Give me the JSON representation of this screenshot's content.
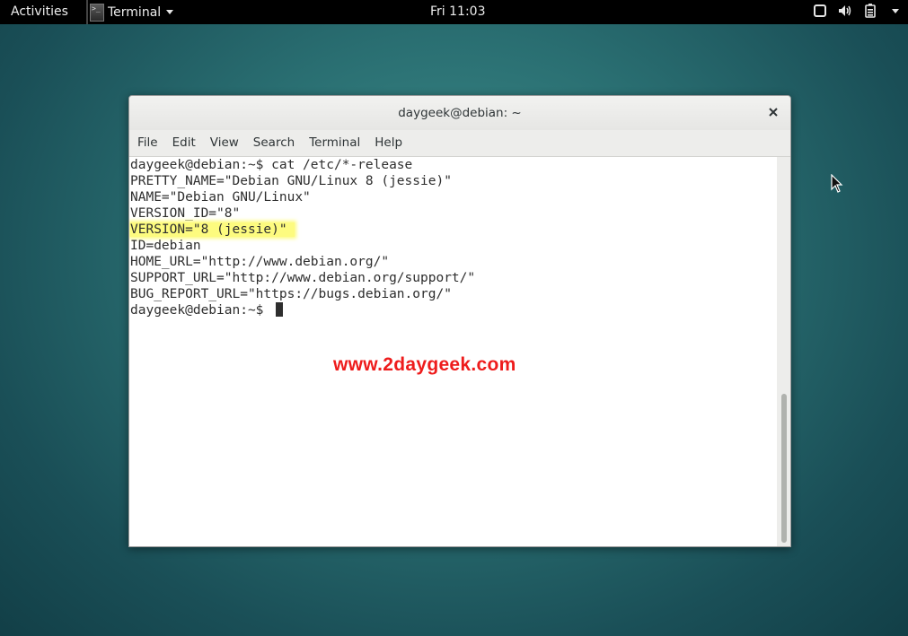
{
  "topbar": {
    "activities_label": "Activities",
    "app_menu_label": "Terminal",
    "app_icon_glyph": ">_",
    "clock": "Fri 11:03",
    "tray_icons": [
      "window-icon",
      "volume-icon",
      "battery-icon",
      "chevron-down-icon"
    ]
  },
  "window": {
    "title": "daygeek@debian: ~",
    "menu": [
      "File",
      "Edit",
      "View",
      "Search",
      "Terminal",
      "Help"
    ]
  },
  "terminal": {
    "lines": [
      "daygeek@debian:~$ cat /etc/*-release",
      "PRETTY_NAME=\"Debian GNU/Linux 8 (jessie)\"",
      "NAME=\"Debian GNU/Linux\"",
      "VERSION_ID=\"8\"",
      "VERSION=\"8 (jessie)\"",
      "ID=debian",
      "HOME_URL=\"http://www.debian.org/\"",
      "SUPPORT_URL=\"http://www.debian.org/support/\"",
      "BUG_REPORT_URL=\"https://bugs.debian.org/\"",
      "daygeek@debian:~$ "
    ],
    "highlighted_line": "VERSION=\"8 (jessie)\"",
    "watermark": "www.2daygeek.com"
  },
  "colors": {
    "topbar_bg": "#000000",
    "highlight": "#fdfb7f",
    "watermark": "#ee1c1c",
    "desktop": "#2a6f72"
  }
}
